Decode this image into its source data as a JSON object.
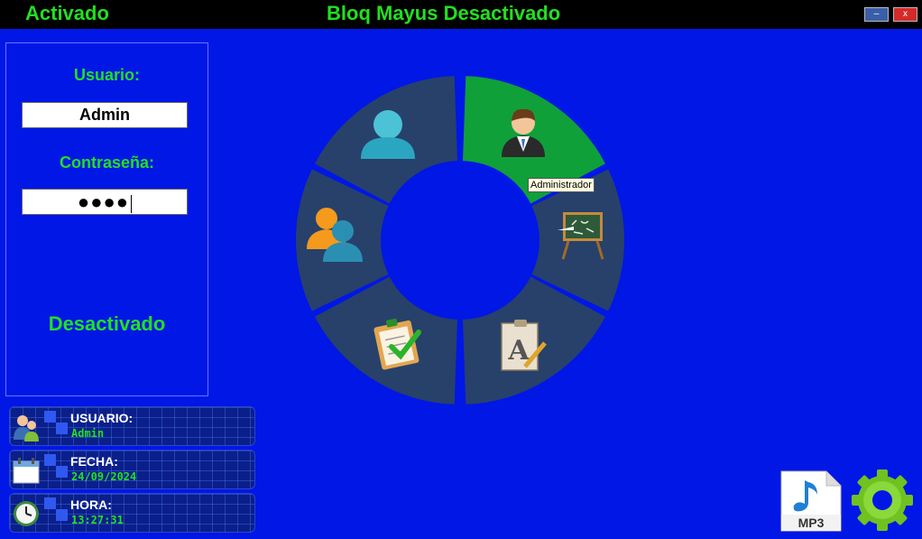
{
  "header": {
    "caps_state": "Activado",
    "caps_message": "Bloq Mayus Desactivado",
    "minimize_label": "–",
    "close_label": "x"
  },
  "login": {
    "user_label": "Usuario:",
    "user_value": "Admin",
    "password_label": "Contraseña:",
    "password_mask": "●●●●",
    "mode_status": "Desactivado"
  },
  "menu": {
    "items": [
      {
        "name": "administrador",
        "icon": "admin-user-icon",
        "active": true
      },
      {
        "name": "profesor",
        "icon": "chalkboard-icon",
        "active": false
      },
      {
        "name": "materias",
        "icon": "grammar-document-icon",
        "active": false
      },
      {
        "name": "tareas",
        "icon": "checklist-icon",
        "active": false
      },
      {
        "name": "grupos",
        "icon": "users-group-icon",
        "active": false
      },
      {
        "name": "usuario",
        "icon": "user-icon",
        "active": false
      }
    ],
    "tooltip": "Administrador",
    "active_color": "#0fa03a",
    "inactive_color": "#27416b"
  },
  "info": {
    "user": {
      "title": "USUARIO:",
      "value": "Admin"
    },
    "date": {
      "title": "FECHA:",
      "value": "24/09/2024"
    },
    "time": {
      "title": "HORA:",
      "value": "13:27:31"
    }
  },
  "dock": {
    "mp3_label": "MP3"
  },
  "colors": {
    "background": "#0017e6",
    "accent_green": "#22e01f"
  }
}
